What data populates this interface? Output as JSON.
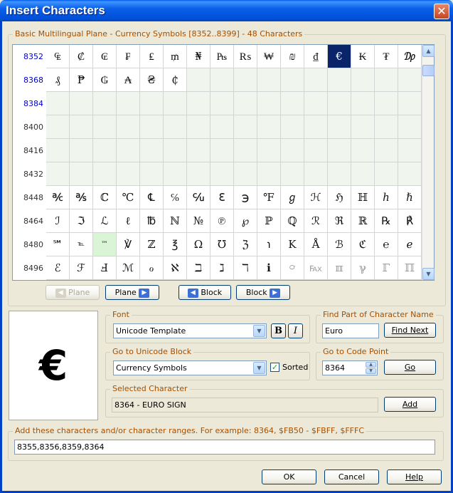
{
  "window": {
    "title": "Insert Characters",
    "close_glyph": "✕"
  },
  "grid": {
    "title": "Basic Multilingual Plane - Currency Symbols [8352..8399] - 48 Characters",
    "rows": [
      {
        "label": "8352",
        "defined": true,
        "chars": [
          "₠",
          "₡",
          "₢",
          "₣",
          "₤",
          "₥",
          "₦",
          "₧",
          "₨",
          "₩",
          "₪",
          "₫",
          "€",
          "₭",
          "₮",
          "₯"
        ]
      },
      {
        "label": "8368",
        "defined": true,
        "chars": [
          "₰",
          "₱",
          "₲",
          "₳",
          "₴",
          "₵",
          "",
          "",
          "",
          "",
          "",
          "",
          "",
          "",
          "",
          ""
        ]
      },
      {
        "label": "8384",
        "defined": true,
        "chars": [
          "",
          "",
          "",
          "",
          "",
          "",
          "",
          "",
          "",
          "",
          "",
          "",
          "",
          "",
          "",
          ""
        ]
      },
      {
        "label": "8400",
        "defined": false,
        "chars": [
          "",
          "",
          "",
          "",
          "",
          "",
          "",
          "",
          "",
          "",
          "",
          "",
          "",
          "",
          "",
          ""
        ]
      },
      {
        "label": "8416",
        "defined": false,
        "chars": [
          "",
          "",
          "",
          "",
          "",
          "",
          "",
          "",
          "",
          "",
          "",
          "",
          "",
          "",
          "",
          ""
        ]
      },
      {
        "label": "8432",
        "defined": false,
        "chars": [
          "",
          "",
          "",
          "",
          "",
          "",
          "",
          "",
          "",
          "",
          "",
          "",
          "",
          "",
          "",
          ""
        ]
      },
      {
        "label": "8448",
        "defined": false,
        "chars": [
          "℀",
          "℁",
          "ℂ",
          "℃",
          "℄",
          "℅",
          "℆",
          "ℇ",
          "℈",
          "℉",
          "ℊ",
          "ℋ",
          "ℌ",
          "ℍ",
          "ℎ",
          "ℏ"
        ]
      },
      {
        "label": "8464",
        "defined": false,
        "chars": [
          "ℐ",
          "ℑ",
          "ℒ",
          "ℓ",
          "℔",
          "ℕ",
          "№",
          "℗",
          "℘",
          "ℙ",
          "ℚ",
          "ℛ",
          "ℜ",
          "ℝ",
          "℞",
          "℟"
        ]
      },
      {
        "label": "8480",
        "defined": false,
        "chars": [
          "℠",
          "℡",
          "™",
          "℣",
          "ℤ",
          "℥",
          "Ω",
          "℧",
          "ℨ",
          "℩",
          "K",
          "Å",
          "ℬ",
          "ℭ",
          "℮",
          "ℯ"
        ]
      },
      {
        "label": "8496",
        "defined": false,
        "chars": [
          "ℰ",
          "ℱ",
          "Ⅎ",
          "ℳ",
          "ℴ",
          "ℵ",
          "ℶ",
          "ℷ",
          "ℸ",
          "ℹ",
          "℺",
          "℻",
          "ℼ",
          "ℽ",
          "ℾ",
          "ℿ"
        ]
      }
    ],
    "selected": {
      "row": 0,
      "col": 12
    },
    "highlighted": {
      "row": 8,
      "col": 2
    }
  },
  "nav": {
    "prev_plane": "Plane",
    "next_plane": "Plane",
    "prev_block": "Block",
    "next_block": "Block"
  },
  "preview": {
    "glyph": "€"
  },
  "font": {
    "group_title": "Font",
    "value": "Unicode Template",
    "bold_label": "B",
    "italic_label": "I"
  },
  "find": {
    "group_title": "Find Part of Character Name",
    "value": "Euro",
    "button": "Find Next"
  },
  "block": {
    "group_title": "Go to Unicode Block",
    "value": "Currency Symbols",
    "sorted_label": "Sorted",
    "sorted_checked": true
  },
  "codepoint": {
    "group_title": "Go to Code Point",
    "value": "8364",
    "button": "Go"
  },
  "selected_char": {
    "group_title": "Selected Character",
    "value": "8364 - EURO SIGN",
    "button": "Add"
  },
  "add_ranges": {
    "group_title": "Add these characters and/or character ranges. For example: 8364, $FB50 - $FBFF, $FFFC",
    "value": "8355,8356,8359,8364"
  },
  "footer": {
    "ok": "OK",
    "cancel": "Cancel",
    "help": "Help"
  },
  "colors": {
    "title_bar": "#0a5fe8",
    "group_title": "#a54f00",
    "selected_cell": "#0a246a",
    "defined_row_label": "#0000cc",
    "empty_cell": "#f0f6ee"
  }
}
